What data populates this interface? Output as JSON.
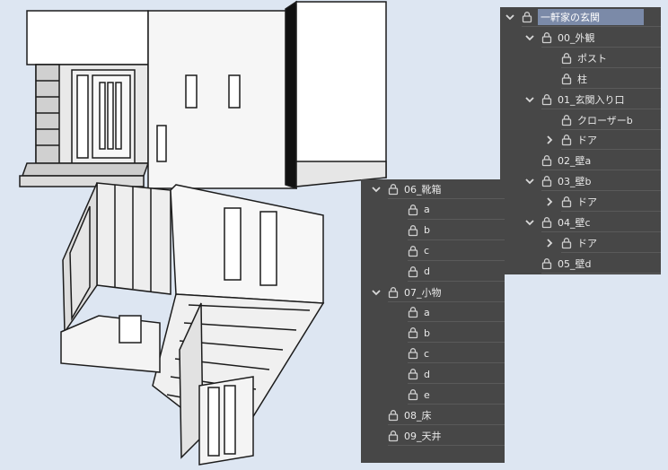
{
  "scene": {
    "description_colors": {
      "bg": "#dde6f2",
      "wall": "#f2f2f2",
      "line": "#222222"
    }
  },
  "panel_top": {
    "items": [
      {
        "label": "一軒家の玄関",
        "depth": 0,
        "chevron": "down",
        "selected": true
      },
      {
        "label": "00_外観",
        "depth": 1,
        "chevron": "down"
      },
      {
        "label": "ポスト",
        "depth": 2,
        "chevron": "none"
      },
      {
        "label": "柱",
        "depth": 2,
        "chevron": "none"
      },
      {
        "label": "01_玄関入り口",
        "depth": 1,
        "chevron": "down"
      },
      {
        "label": "クローザーb",
        "depth": 2,
        "chevron": "none"
      },
      {
        "label": "ドア",
        "depth": 2,
        "chevron": "right"
      },
      {
        "label": "02_壁a",
        "depth": 1,
        "chevron": "none"
      },
      {
        "label": "03_壁b",
        "depth": 1,
        "chevron": "down"
      },
      {
        "label": "ドア",
        "depth": 2,
        "chevron": "right"
      },
      {
        "label": "04_壁c",
        "depth": 1,
        "chevron": "down"
      },
      {
        "label": "ドア",
        "depth": 2,
        "chevron": "right"
      },
      {
        "label": "05_壁d",
        "depth": 1,
        "chevron": "none"
      }
    ]
  },
  "panel_bottom": {
    "items": [
      {
        "label": "06_靴箱",
        "depth": 0,
        "chevron": "down"
      },
      {
        "label": "a",
        "depth": 1,
        "chevron": "none"
      },
      {
        "label": "b",
        "depth": 1,
        "chevron": "none"
      },
      {
        "label": "c",
        "depth": 1,
        "chevron": "none"
      },
      {
        "label": "d",
        "depth": 1,
        "chevron": "none"
      },
      {
        "label": "07_小物",
        "depth": 0,
        "chevron": "down"
      },
      {
        "label": "a",
        "depth": 1,
        "chevron": "none"
      },
      {
        "label": "b",
        "depth": 1,
        "chevron": "none"
      },
      {
        "label": "c",
        "depth": 1,
        "chevron": "none"
      },
      {
        "label": "d",
        "depth": 1,
        "chevron": "none"
      },
      {
        "label": "e",
        "depth": 1,
        "chevron": "none"
      },
      {
        "label": "08_床",
        "depth": 0,
        "chevron": "none"
      },
      {
        "label": "09_天井",
        "depth": 0,
        "chevron": "none"
      }
    ]
  }
}
